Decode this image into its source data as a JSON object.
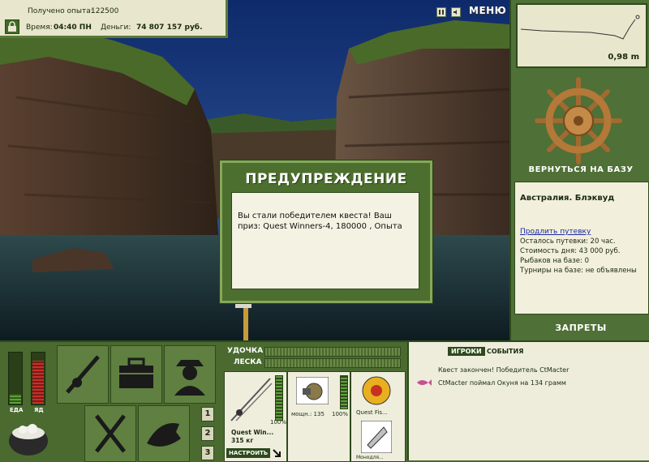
{
  "hud": {
    "experience_label": "Получено опыта:",
    "experience_value": "122500",
    "time_label": "Время:",
    "time_value": "04:40 ПН",
    "money_label": "Деньги:",
    "money_value": "74 807 157 руб.",
    "menu_label": "МЕНЮ"
  },
  "depth": {
    "value": "0,98 m"
  },
  "right_panel": {
    "return_label": "ВЕРНУТЬСЯ НА БАЗУ",
    "location": "Австралия. Блэквуд",
    "extend_link": "Продлить путевку",
    "lines": [
      "Осталось путевки: 20 час.",
      "Стоимость дня: 43 000 руб.",
      "Рыбаков на базе: 0",
      "Турниры на базе: не объявлены"
    ],
    "bans_label": "ЗАПРЕТЫ"
  },
  "dialog": {
    "title": "ПРЕДУПРЕЖДЕНИЕ",
    "message": "Вы стали победителем квеста! Ваш приз: Quest Winners-4, 180000 , Опыта"
  },
  "status_bars": {
    "food_label": "ЕДА",
    "bait_label": "ЯД",
    "food_level": 0.2,
    "bait_level": 0.85
  },
  "quick_slots": {
    "numbers": [
      "1",
      "2",
      "3"
    ]
  },
  "tackle": {
    "rod_label": "УДОЧКА",
    "line_label": "ЛЕСКА",
    "rod_name": "Quest Win...",
    "rod_weight": "315 кг",
    "setup_button": "НАСТРОИТЬ",
    "rod_percent": "100%",
    "reel_power": "мощн.: 135",
    "reel_percent": "100%",
    "line_name": "Quest Fis...",
    "lure_name": "Монодля..."
  },
  "events": {
    "tab_players": "ИГРОКИ",
    "tab_events": "СОБЫТИЯ",
    "items": [
      "Квест закончен! Победитель CtMacter",
      "CtMacter поймал Окуня на 134 грамм"
    ]
  },
  "colors": {
    "panel_green": "#4a6a30",
    "cream": "#e8e6cc",
    "food_green": "#5ea03a",
    "bait_red": "#c8302a"
  }
}
